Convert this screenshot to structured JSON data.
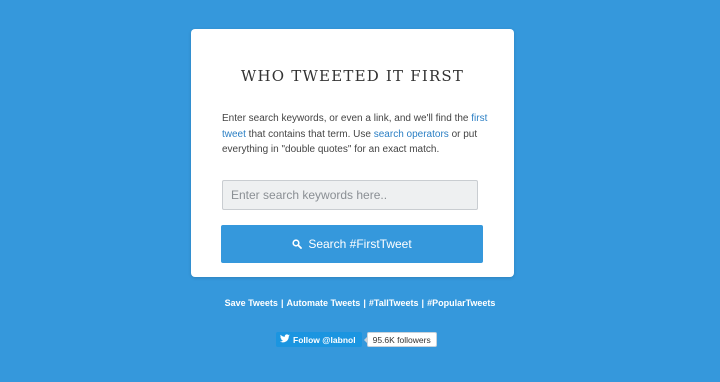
{
  "card": {
    "title": "WHO TWEETED IT FIRST",
    "desc_part1": "Enter search keywords, or even a link, and we'll find the ",
    "desc_link1": "first tweet",
    "desc_part2": " that contains that term. Use ",
    "desc_link2": "search operators",
    "desc_part3": " or put everything in \"double quotes\" for an exact match.",
    "search_placeholder": "Enter search keywords here..",
    "search_button_label": "Search #FirstTweet",
    "search_icon": "search-icon"
  },
  "footer": {
    "links": [
      "Save Tweets",
      "Automate Tweets",
      "#TallTweets",
      "#PopularTweets"
    ],
    "separator": "|"
  },
  "twitter": {
    "follow_label": "Follow @labnol",
    "followers": "95.6K followers",
    "bird_icon": "twitter-bird-icon"
  },
  "colors": {
    "background": "#3598dc",
    "button": "#3598dc",
    "link": "#2b7fc4",
    "twitter_blue": "#1b95e0"
  }
}
